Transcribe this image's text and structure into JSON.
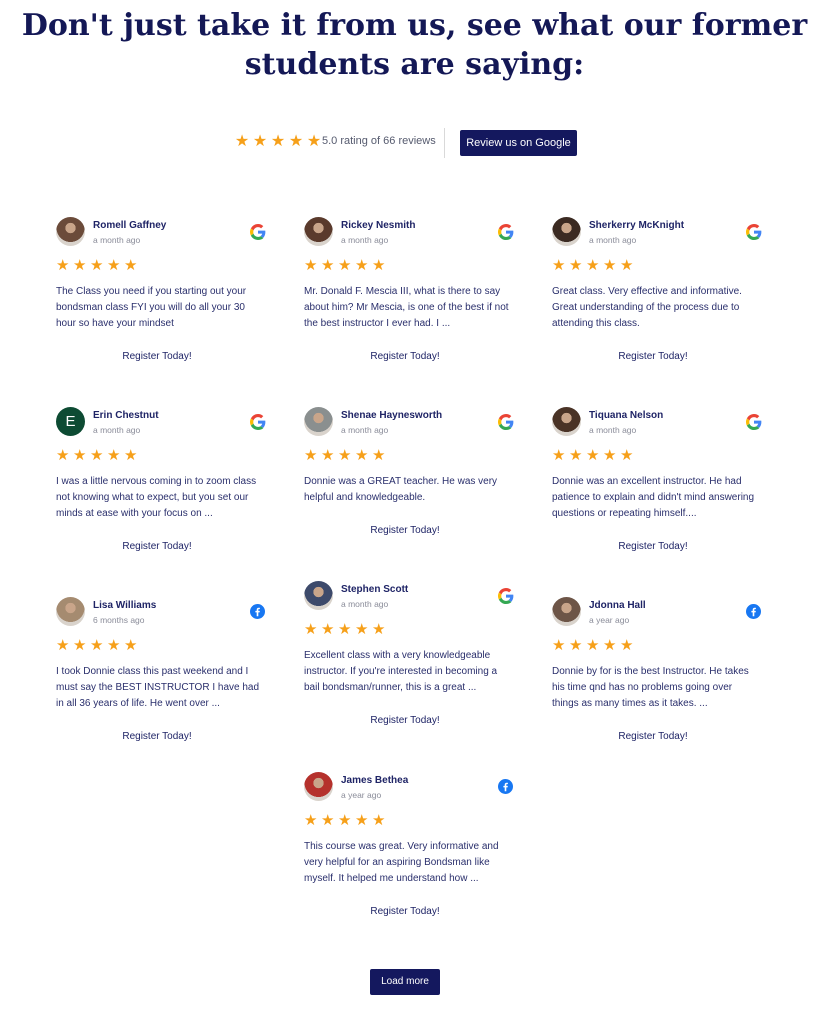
{
  "heading": {
    "line1": "Don't just take it from us, see what our former",
    "line2": "students are saying:"
  },
  "summary": {
    "rating_text": "5.0 rating of 66 reviews",
    "stars": 5,
    "review_button": "Review us on Google"
  },
  "colors": {
    "accent": "#14185e",
    "star": "#f6a01a",
    "facebook": "#1877f2"
  },
  "reviews": [
    {
      "name": "Romell Gaffney",
      "date": "a month ago",
      "source": "google",
      "stars": 5,
      "text": "The Class you need if you starting out your bondsman class FYI you will do all your 30 hour so have your mindset",
      "cta": "Register Today!"
    },
    {
      "name": "Rickey Nesmith",
      "date": "a month ago",
      "source": "google",
      "stars": 5,
      "text": "Mr. Donald F. Mescia III, what is there to say about him?  Mr Mescia, is one of the best if not the best instructor I ever had.  I ...",
      "cta": "Register Today!"
    },
    {
      "name": "Sherkerry McKnight",
      "date": "a month ago",
      "source": "google",
      "stars": 5,
      "text": "Great class. Very effective and informative. Great understanding of the process due to attending this class.",
      "cta": "Register Today!"
    },
    {
      "name": "Erin Chestnut",
      "date": "a month ago",
      "source": "google",
      "stars": 5,
      "avatar_letter": "E",
      "text": "I was a little nervous coming in to zoom class not knowing what to expect, but you set our minds at ease with your focus on ...",
      "cta": "Register Today!"
    },
    {
      "name": "Shenae Haynesworth",
      "date": "a month ago",
      "source": "google",
      "stars": 5,
      "text": "Donnie was a GREAT teacher. He was very helpful and knowledgeable.",
      "cta": "Register Today!"
    },
    {
      "name": "Tiquana Nelson",
      "date": "a month ago",
      "source": "google",
      "stars": 5,
      "text": "Donnie was an excellent instructor.  He had patience to explain and didn't mind answering questions or repeating himself....",
      "cta": "Register Today!"
    },
    {
      "name": "Lisa Williams",
      "date": "6 months ago",
      "source": "facebook",
      "stars": 5,
      "text": "I took Donnie class this past weekend and I must say the BEST INSTRUCTOR I have had in all 36 years of life. He went over ...",
      "cta": "Register Today!"
    },
    {
      "name": "Stephen Scott",
      "date": "a month ago",
      "source": "google",
      "stars": 5,
      "text": "Excellent class with a very knowledgeable instructor. If you're interested in becoming a bail bondsman/runner, this is a great ...",
      "cta": "Register Today!"
    },
    {
      "name": "Jdonna Hall",
      "date": "a year ago",
      "source": "facebook",
      "stars": 5,
      "text": "Donnie by for is the best Instructor.  He takes his time qnd has no problems going over things as many times as it takes.  ...",
      "cta": "Register Today!"
    },
    {
      "name": "James Bethea",
      "date": "a year ago",
      "source": "facebook",
      "stars": 5,
      "text": "This course was great. Very informative and very helpful for an aspiring Bondsman like myself. It helped me understand how ...",
      "cta": "Register Today!"
    }
  ],
  "load_more": "Load more"
}
